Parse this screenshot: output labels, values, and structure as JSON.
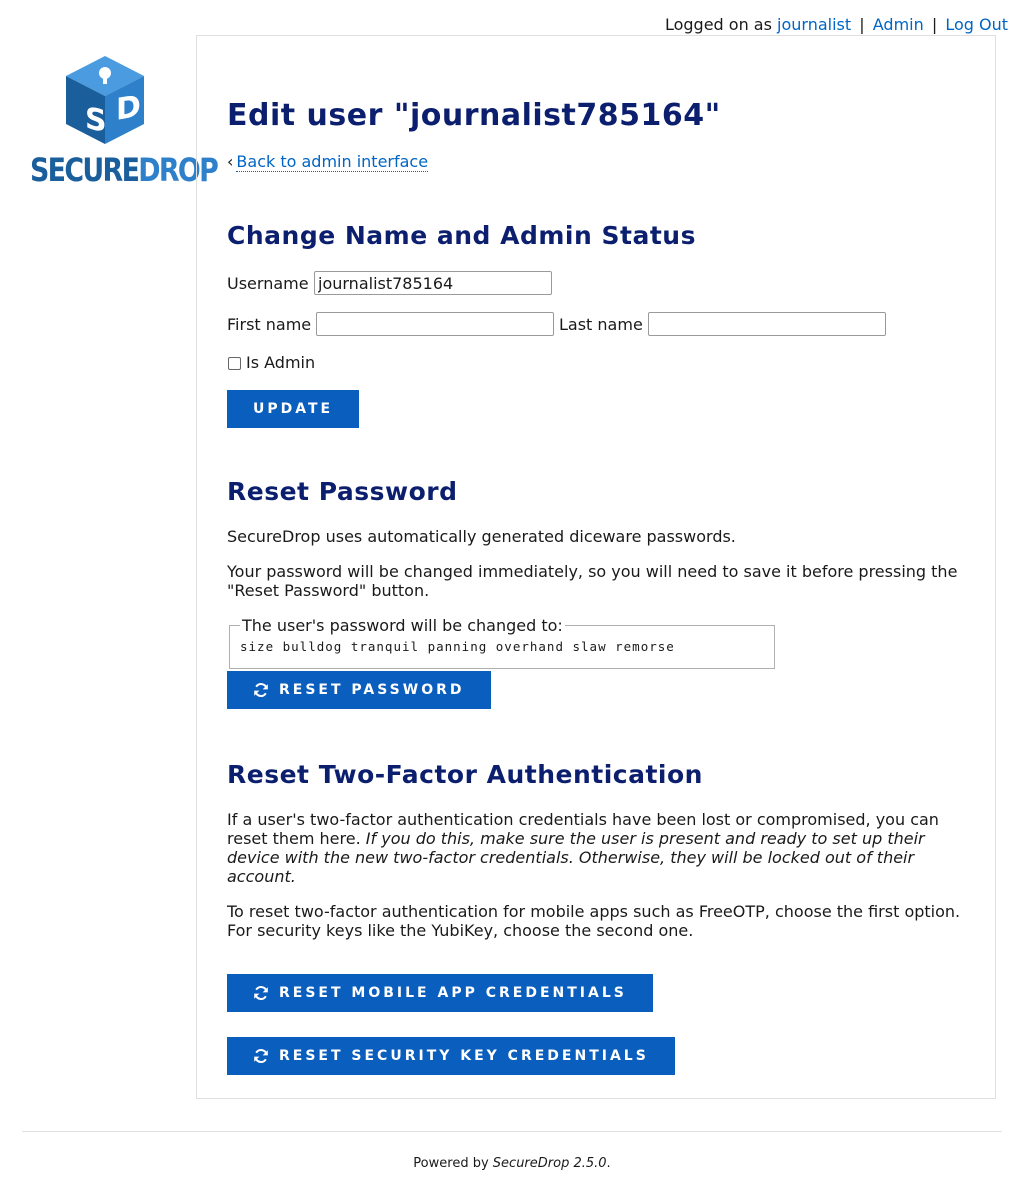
{
  "topbar": {
    "logged_prefix": "Logged on as",
    "username": "journalist",
    "sep": "|",
    "admin_link": "Admin",
    "logout_link": "Log Out"
  },
  "logo": {
    "word1": "SECURE",
    "word2": "DROP",
    "icon": "securedrop-cube-icon",
    "colors": {
      "dark": "#1b5e9c",
      "light": "#2d80c9"
    }
  },
  "page": {
    "title": "Edit user \"journalist785164\"",
    "back_link": "Back to admin interface"
  },
  "change_name": {
    "heading": "Change Name and Admin Status",
    "username_label": "Username",
    "username_value": "journalist785164",
    "first_name_label": "First name",
    "first_name_value": "",
    "last_name_label": "Last name",
    "last_name_value": "",
    "is_admin_label": "Is Admin",
    "is_admin_checked": false,
    "update_button": "UPDATE"
  },
  "reset_password": {
    "heading": "Reset Password",
    "para1": "SecureDrop uses automatically generated diceware passwords.",
    "para2": "Your password will be changed immediately, so you will need to save it before pressing the \"Reset Password\" button.",
    "legend": "The user's password will be changed to:",
    "new_password": "size bulldog tranquil panning overhand slaw remorse",
    "button": "RESET PASSWORD",
    "button_icon": "refresh-icon"
  },
  "two_factor": {
    "heading": "Reset Two-Factor Authentication",
    "para1_plain": "If a user's two-factor authentication credentials have been lost or compromised, you can reset them here.",
    "para1_italic": "If you do this, make sure the user is present and ready to set up their device with the new two-factor credentials. Otherwise, they will be locked out of their account.",
    "para2": "To reset two-factor authentication for mobile apps such as FreeOTP, choose the first option. For security keys like the YubiKey, choose the second one.",
    "mobile_button": "RESET MOBILE APP CREDENTIALS",
    "key_button": "RESET SECURITY KEY CREDENTIALS"
  },
  "footer": {
    "prefix": "Powered by",
    "product": "SecureDrop 2.5.0",
    "suffix": "."
  },
  "colors": {
    "heading": "#0c1f6e",
    "button": "#0a5ebd",
    "link": "#0065c4"
  }
}
